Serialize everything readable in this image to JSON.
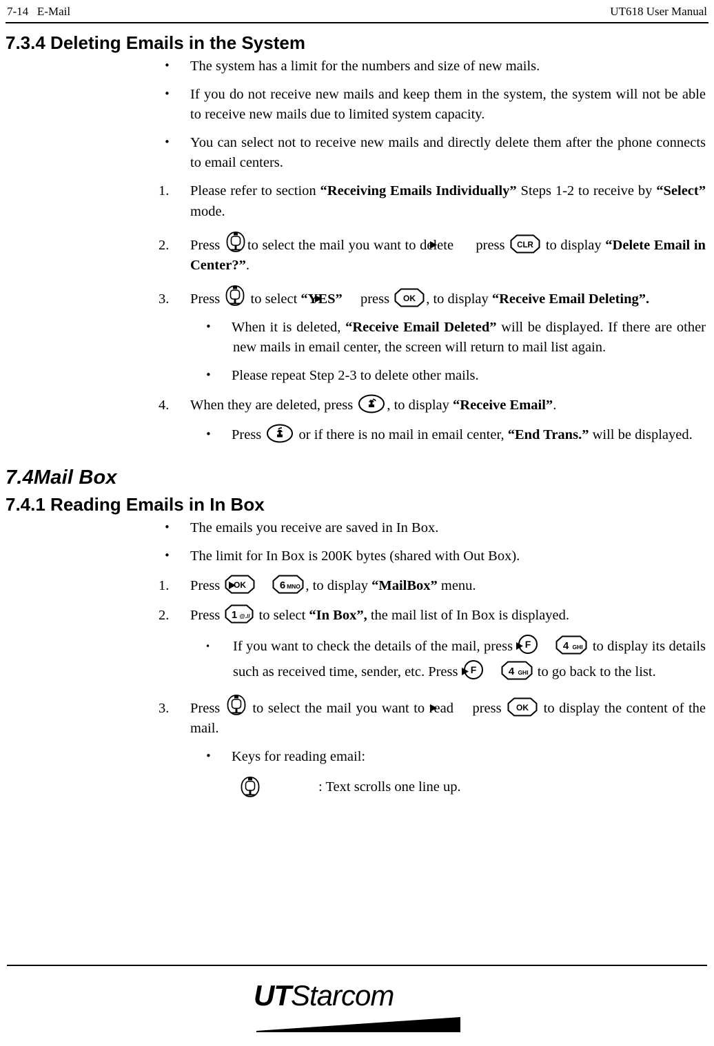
{
  "header": {
    "left": "7-14   E-Mail",
    "right": "UT618 User Manual"
  },
  "sections": {
    "s734": {
      "number": "7.3.4",
      "title": "7.3.4 Deleting Emails in the System"
    },
    "s74": {
      "number": "7.4",
      "title": "Mail Box"
    },
    "s741": {
      "title": "7.4.1 Reading Emails in In Box"
    }
  },
  "body": {
    "b1": "The system has a limit for the numbers and size of new mails.",
    "b2": "If you do not receive new mails and keep them in the system, the system will not be able to receive new mails due to limited system capacity.",
    "b3": "You can select not to receive new mails and directly delete them after the phone connects to email centers.",
    "n1_a": "Please refer to section ",
    "n1_b": "“Receiving Emails Individually”",
    "n1_c": " Steps 1-2 to receive by ",
    "n1_d": "“Select”",
    "n1_e": " mode.",
    "n1_label": "1.",
    "n2_label": "2.",
    "n2_a": "Press ",
    "n2_b": "to select the mail you want to delete ",
    "n2_c": " press ",
    "n2_d": " to display ",
    "n2_e": "“Delete Email in Center?”",
    "n2_f": ".",
    "n3_label": "3.",
    "n3_a": "Press ",
    "n3_b": " to select ",
    "n3_c": "“YES”",
    "n3_d": " press ",
    "n3_e": ", to display ",
    "n3_f": "“Receive Email Deleting”",
    "n3_g": ".",
    "b4_a": "When it is deleted, ",
    "b4_b": "“Receive Email Deleted”",
    "b4_c": " will be displayed. If there are other new mails in email center, the screen will return to mail list again.",
    "b5": "Please repeat Step 2-3 to delete other mails.",
    "n4_label": "4.",
    "n4_a": "When they are deleted, press ",
    "n4_b": ", to display ",
    "n4_c": "“Receive Email”",
    "n4_d": ".",
    "b6_a": "Press ",
    "b6_b": " or if there is no mail in email center, ",
    "b6_c": "“End Trans.”",
    "b6_d": " will be displayed.",
    "b7": "The emails you receive are saved in In Box.",
    "b8": "The limit for In Box is 200K bytes (shared with Out Box).",
    "m1_label": "1.",
    "m1_a": "Press ",
    "m1_b": ", to display ",
    "m1_c": "“MailBox”",
    "m1_d": " menu.",
    "m2_label": "2.",
    "m2_a": "Press ",
    "m2_b": " to select ",
    "m2_c": "“In Box”,",
    "m2_d": " the mail list of In Box is displayed.",
    "b9_a": "If you want to check the details of the mail, press ",
    "b9_b": " to display its details such as received time, sender, etc. Press ",
    "b9_c": " to go back to the list.",
    "m3_label": "3.",
    "m3_a": "Press ",
    "m3_b": " to select the mail you want to read ",
    "m3_c": "press ",
    "m3_d": " to display the content of the mail.",
    "b10": "Keys for reading email:",
    "key_legend_1": ": Text scrolls one line up."
  },
  "keys": {
    "nav": "nav-scroll-key",
    "clr": "CLR",
    "ok": "OK",
    "end": "end-call-key",
    "send": "send-call-key",
    "six": "6",
    "six_sub": "MNO",
    "one": "1",
    "one_sub": "@.//",
    "four": "4",
    "four_sub": "GHI",
    "f": "F",
    "arrow": "right-arrow"
  },
  "footer": {
    "logo_ut": "UT",
    "logo_starcom": "Starcom"
  },
  "colors": {
    "ink": "#000000",
    "page": "#ffffff"
  }
}
